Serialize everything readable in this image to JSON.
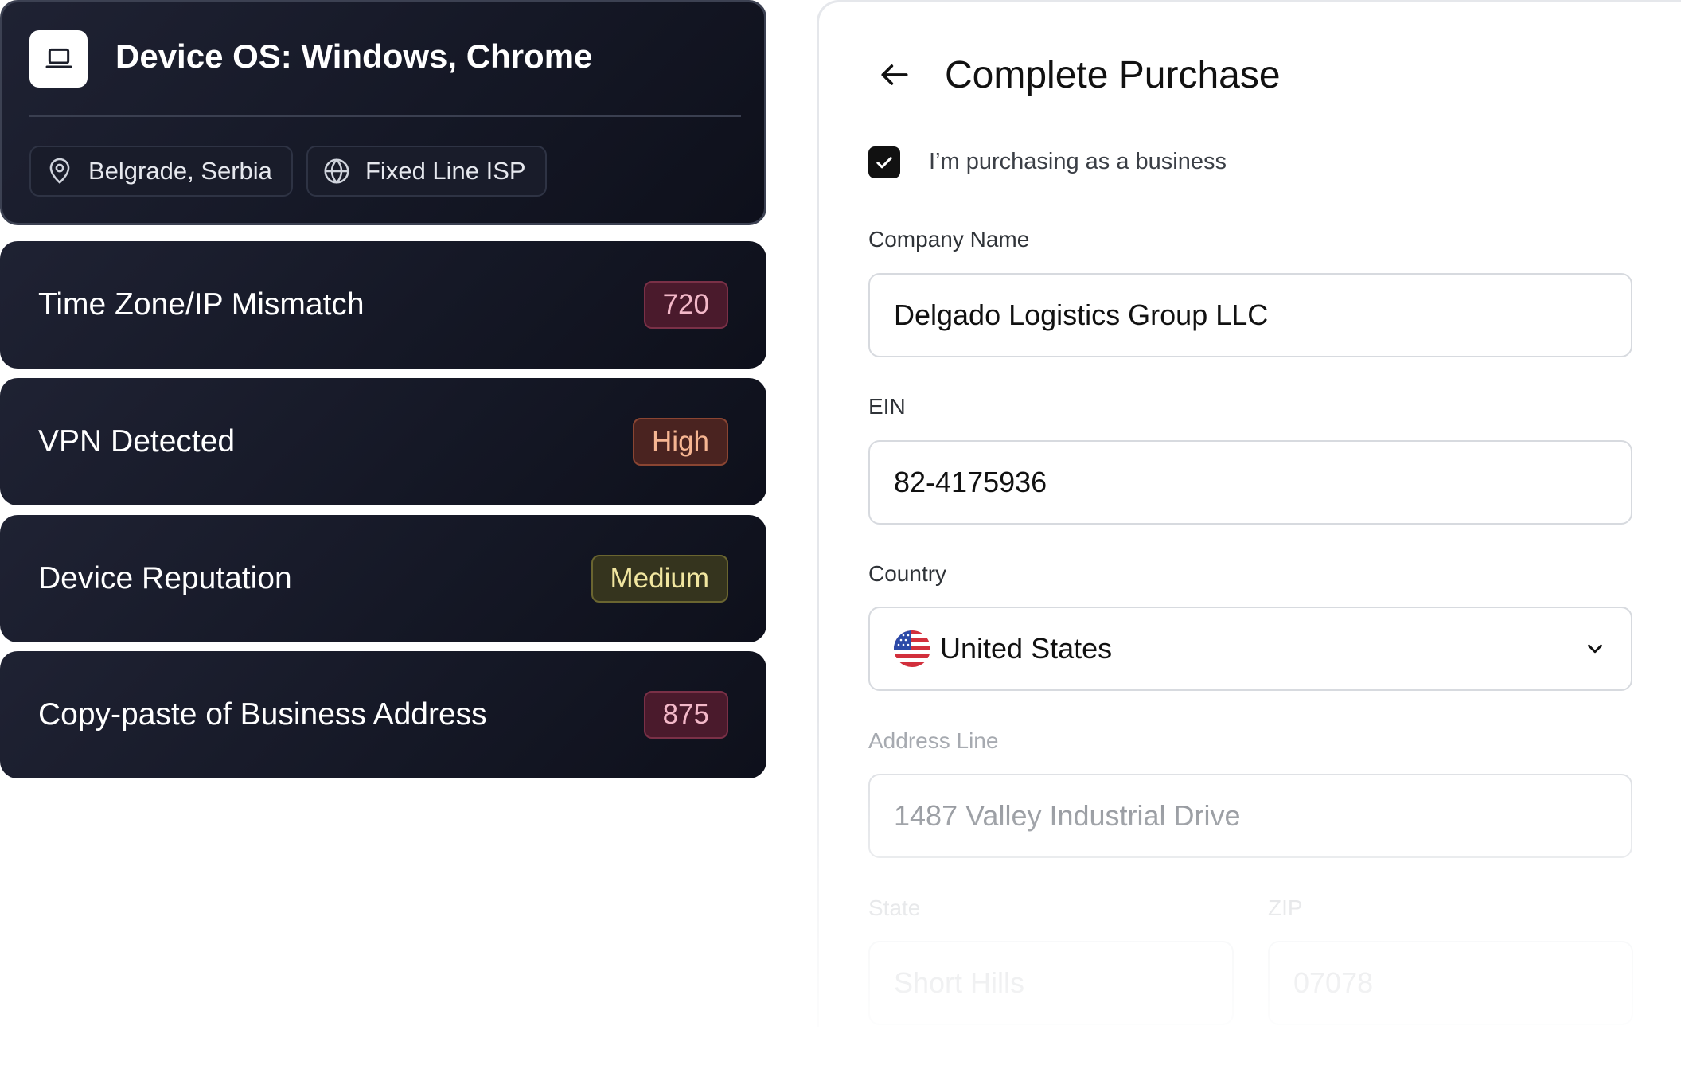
{
  "device": {
    "title": "Device OS: Windows, Chrome",
    "icon": "laptop-icon",
    "chips": [
      {
        "icon": "location-pin-icon",
        "label": "Belgrade, Serbia"
      },
      {
        "icon": "globe-icon",
        "label": "Fixed Line ISP"
      }
    ]
  },
  "signals": [
    {
      "label": "Time Zone/IP Mismatch",
      "badge": "720",
      "color": "#4a1a2c"
    },
    {
      "label": "VPN Detected",
      "badge": "High",
      "color": "#4a2320"
    },
    {
      "label": "Device Reputation",
      "badge": "Medium",
      "color": "#35341e"
    },
    {
      "label": "Copy-paste of Business Address",
      "badge": "875",
      "color": "#4a1a2c"
    }
  ],
  "form": {
    "title": "Complete Purchase",
    "business_checkbox": {
      "label": "I’m purchasing as a business",
      "checked": true
    },
    "company_name": {
      "label": "Company Name",
      "value": "Delgado Logistics Group LLC"
    },
    "ein": {
      "label": "EIN",
      "value": "82-4175936"
    },
    "country": {
      "label": "Country",
      "value": "United States",
      "flag": "us-flag-icon"
    },
    "address_line": {
      "label": "Address Line",
      "value": "1487 Valley Industrial Drive"
    },
    "state": {
      "label": "State",
      "value": "Short Hills"
    },
    "zip": {
      "label": "ZIP",
      "value": "07078"
    }
  }
}
